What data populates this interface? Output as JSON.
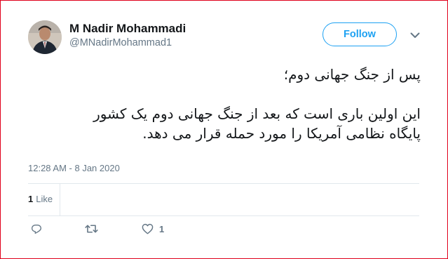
{
  "author": {
    "display_name": "M Nadir Mohammadi",
    "handle": "@MNadirMohammad1",
    "avatar_icon": "profile-photo"
  },
  "follow": {
    "label": "Follow",
    "color": "#1da1f2"
  },
  "menu": {
    "icon": "chevron-down-icon"
  },
  "tweet": {
    "lines": [
      "پس از جنگ جهانی دوم؛",
      "",
      "این اولین باری است که بعد از جنگ جهانی دوم یک کشور",
      "پایگاه نظامی آمریکا را مورد حمله قرار می دهد."
    ],
    "timestamp": "12:28 AM - 8 Jan 2020"
  },
  "stats": {
    "likes_count": "1",
    "likes_label": "Like"
  },
  "actions": {
    "reply_icon": "reply-icon",
    "retweet_icon": "retweet-icon",
    "like_icon": "heart-icon",
    "like_count": "1"
  }
}
